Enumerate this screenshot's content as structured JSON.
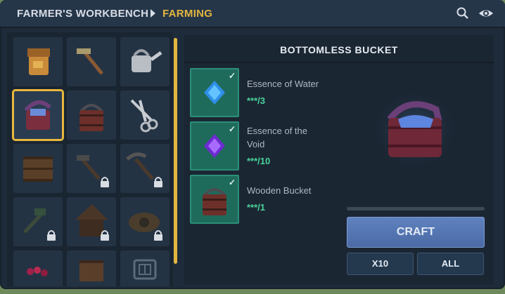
{
  "header": {
    "root": "FARMER'S WORKBENCH",
    "current": "FARMING",
    "icons": [
      "search-icon",
      "eye-icon"
    ]
  },
  "recipe_grid": {
    "items": [
      {
        "name": "seed-sack",
        "locked": false,
        "selected": false
      },
      {
        "name": "hoe",
        "locked": false,
        "selected": false
      },
      {
        "name": "watering-can",
        "locked": false,
        "selected": false
      },
      {
        "name": "bottomless-bucket",
        "locked": false,
        "selected": true
      },
      {
        "name": "wooden-bucket",
        "locked": false,
        "selected": false
      },
      {
        "name": "shears",
        "locked": false,
        "selected": false
      },
      {
        "name": "crate",
        "locked": false,
        "selected": false
      },
      {
        "name": "locked-tool-1",
        "locked": true,
        "selected": false
      },
      {
        "name": "locked-tool-2",
        "locked": true,
        "selected": false
      },
      {
        "name": "locked-tool-3",
        "locked": true,
        "selected": false
      },
      {
        "name": "locked-house",
        "locked": true,
        "selected": false
      },
      {
        "name": "locked-machine",
        "locked": true,
        "selected": false
      },
      {
        "name": "berries",
        "locked": false,
        "selected": false
      },
      {
        "name": "box",
        "locked": false,
        "selected": false
      },
      {
        "name": "rune",
        "locked": false,
        "selected": false
      }
    ]
  },
  "detail": {
    "title": "BOTTOMLESS BUCKET",
    "ingredients": [
      {
        "name": "Essence of Water",
        "count": "***/3"
      },
      {
        "name_line1": "Essence of the",
        "name_line2": "Void",
        "count": "***/10"
      },
      {
        "name": "Wooden Bucket",
        "count": "***/1"
      }
    ],
    "buttons": {
      "craft": "CRAFT",
      "x10": "X10",
      "all": "ALL"
    },
    "craft_progress": 0.0
  },
  "colors": {
    "accent": "#e3b640",
    "ingredient_bg": "#1f6b5b",
    "craft_button": "#5f82bf"
  }
}
